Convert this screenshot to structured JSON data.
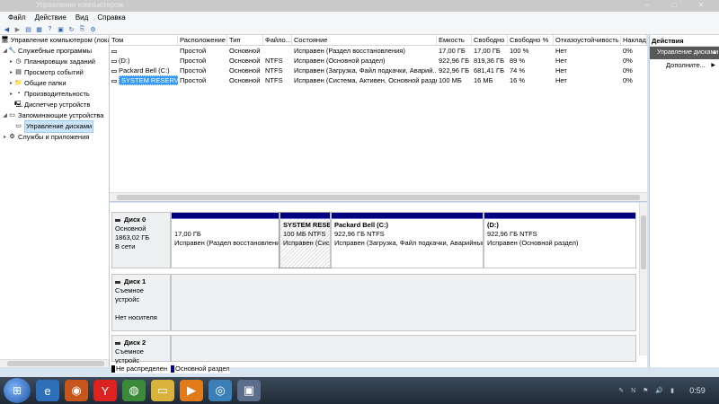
{
  "window": {
    "title": "Управление компьютером"
  },
  "menu": [
    "Файл",
    "Действие",
    "Вид",
    "Справка"
  ],
  "toolbar": {
    "icons": [
      "back-icon",
      "forward-icon",
      "up-icon",
      "show-hide-tree-icon",
      "help-icon",
      "properties-icon",
      "refresh-icon",
      "export-icon",
      "settings-icon"
    ]
  },
  "tree": {
    "items": [
      {
        "label": "Управление компьютером (лока",
        "level": 0,
        "icon": "computer-icon"
      },
      {
        "label": "Служебные программы",
        "level": 1,
        "icon": "tools-icon"
      },
      {
        "label": "Планировщик заданий",
        "level": 2,
        "icon": "scheduler-icon"
      },
      {
        "label": "Просмотр событий",
        "level": 2,
        "icon": "event-viewer-icon"
      },
      {
        "label": "Общие папки",
        "level": 2,
        "icon": "shared-folders-icon"
      },
      {
        "label": "Производительность",
        "level": 2,
        "icon": "performance-icon"
      },
      {
        "label": "Диспетчер устройств",
        "level": 2,
        "icon": "device-manager-icon"
      },
      {
        "label": "Запоминающие устройства",
        "level": 1,
        "icon": "storage-icon"
      },
      {
        "label": "Управление дисками",
        "level": 2,
        "icon": "disk-management-icon",
        "selected": true
      },
      {
        "label": "Службы и приложения",
        "level": 1,
        "icon": "services-icon"
      }
    ]
  },
  "volumes": {
    "columns": [
      "Том",
      "Расположение",
      "Тип",
      "Файло...",
      "Состояние",
      "Емкость",
      "Свободно",
      "Свободно %",
      "Отказоустойчивость",
      "Наклад"
    ],
    "rows": [
      [
        "",
        "Простой",
        "Основной",
        "",
        "Исправен (Раздел восстановления)",
        "17,00 ГБ",
        "17,00 ГБ",
        "100 %",
        "Нет",
        "0%"
      ],
      [
        "(D:)",
        "Простой",
        "Основной",
        "NTFS",
        "Исправен (Основной раздел)",
        "922,96 ГБ",
        "819,36 ГБ",
        "89 %",
        "Нет",
        "0%"
      ],
      [
        "Packard Bell (C:)",
        "Простой",
        "Основной",
        "NTFS",
        "Исправен (Загрузка, Файл подкачки, Аварий...",
        "922,96 ГБ",
        "681,41 ГБ",
        "74 %",
        "Нет",
        "0%"
      ],
      [
        "SYSTEM RESERVED",
        "Простой",
        "Основной",
        "NTFS",
        "Исправен (Система, Активен, Основной раздел)",
        "100 МБ",
        "16 МБ",
        "16 %",
        "Нет",
        "0%"
      ]
    ]
  },
  "disks": [
    {
      "name": "Диск 0",
      "type": "Основной",
      "size": "1863,02 ГБ",
      "status": "В сети",
      "partitions": [
        {
          "title": "",
          "size": "17,00 ГБ",
          "state": "Исправен (Раздел восстановлени"
        },
        {
          "title": "SYSTEM RESEI",
          "size": "100 МБ NTFS",
          "state": "Исправен (Сист"
        },
        {
          "title": "Packard Bell  (C:)",
          "size": "922,96 ГБ NTFS",
          "state": "Исправен (Загрузка, Файл подкачки, Аварийный"
        },
        {
          "title": "(D:)",
          "size": "922,96 ГБ NTFS",
          "state": "Исправен (Основной раздел)"
        }
      ]
    },
    {
      "name": "Диск 1",
      "type": "Съемное устройс",
      "size": "",
      "status": "Нет носителя"
    },
    {
      "name": "Диск 2",
      "type": "Съемное устройс",
      "size": "",
      "status": ""
    }
  ],
  "legend": [
    {
      "label": "Не распределен",
      "color": "#000000"
    },
    {
      "label": "Основной раздел",
      "color": "#000080"
    }
  ],
  "actions": {
    "header": "Действия",
    "section": "Управление дисками",
    "more": "Дополните..."
  },
  "taskbar": {
    "apps": [
      "start-icon",
      "ie-icon",
      "firefox-icon",
      "yandex-icon",
      "chrome-icon",
      "explorer-icon",
      "media-player-icon",
      "network-icon",
      "computer-management-icon"
    ],
    "clock": "0:59"
  }
}
